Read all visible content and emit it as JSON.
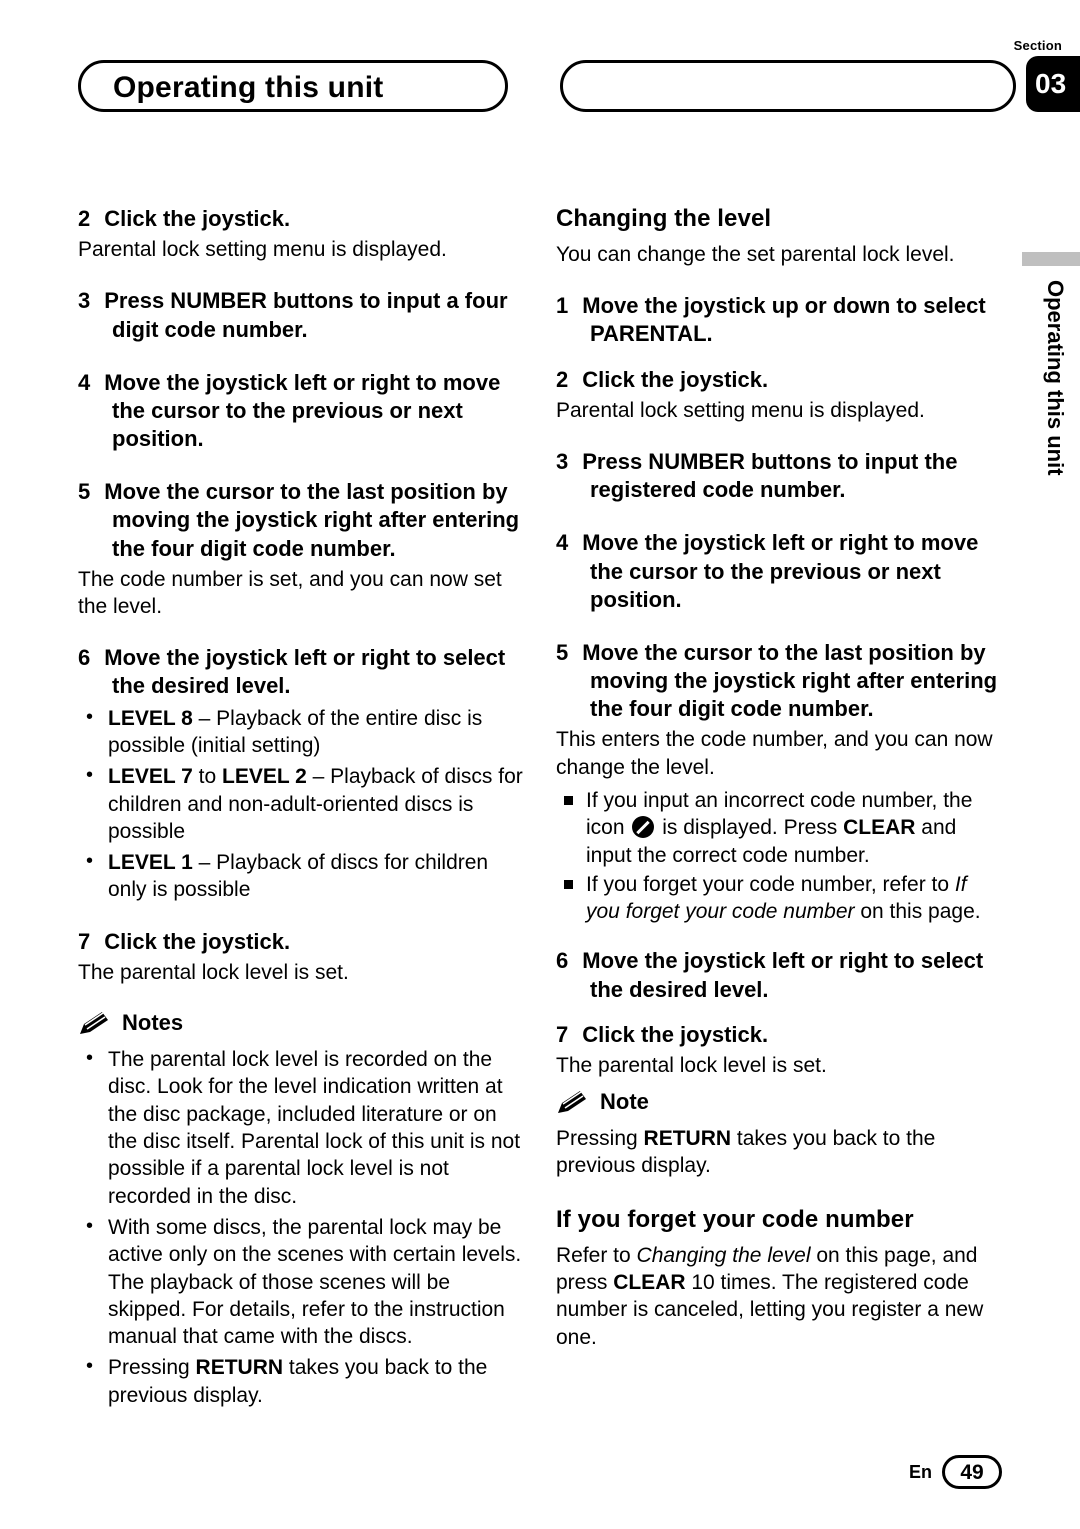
{
  "header": {
    "title": "Operating this unit",
    "section_label": "Section",
    "section_number": "03"
  },
  "side_tab": {
    "text": "Operating this unit"
  },
  "left_column": {
    "step2": {
      "num": "2",
      "text": "Click the joystick."
    },
    "step2_body": "Parental lock setting menu is displayed.",
    "step3": {
      "num": "3",
      "text": "Press NUMBER buttons to input a four digit code number."
    },
    "step4": {
      "num": "4",
      "text": "Move the joystick left or right to move the cursor to the previous or next position."
    },
    "step5": {
      "num": "5",
      "text": "Move the cursor to the last position by moving the joystick right after entering the four digit code number."
    },
    "step5_body": "The code number is set, and you can now set the level.",
    "step6": {
      "num": "6",
      "text": "Move the joystick left or right to select the desired level."
    },
    "levels": [
      {
        "bold": "LEVEL 8",
        "rest": " – Playback of the entire disc is possible (initial setting)"
      },
      {
        "bold": "LEVEL 7",
        "mid": " to ",
        "bold2": "LEVEL 2",
        "rest": " – Playback of discs for children and non-adult-oriented discs is possible"
      },
      {
        "bold": "LEVEL 1",
        "rest": " – Playback of discs for children only is possible"
      }
    ],
    "step7": {
      "num": "7",
      "text": "Click the joystick."
    },
    "step7_body": "The parental lock level is set.",
    "notes_label": "Notes",
    "notes": [
      "The parental lock level is recorded on the disc. Look for the level indication written at the disc package, included literature or on the disc itself. Parental lock of this unit is not possible if a parental lock level is not recorded in the disc.",
      "With some discs, the parental lock may be active only on the scenes with certain levels. The playback of those scenes will be skipped. For details, refer to the instruction manual that came with the discs.",
      "Pressing RETURN takes you back to the previous display."
    ],
    "note3_pre": "Pressing ",
    "note3_bold": "RETURN",
    "note3_post": " takes you back to the previous display."
  },
  "right_column": {
    "heading1": "Changing the level",
    "intro": "You can change the set parental lock level.",
    "step1": {
      "num": "1",
      "text": "Move the joystick up or down to select PARENTAL."
    },
    "step2": {
      "num": "2",
      "text": "Click the joystick."
    },
    "step2_body": "Parental lock setting menu is displayed.",
    "step3": {
      "num": "3",
      "text": "Press NUMBER buttons to input the registered code number."
    },
    "step4": {
      "num": "4",
      "text": "Move the joystick left or right to move the cursor to the previous or next position."
    },
    "step5": {
      "num": "5",
      "text": "Move the cursor to the last position by moving the joystick right after entering the four digit code number."
    },
    "step5_body": "This enters the code number, and you can now change the level.",
    "sq1_pre": "If you input an incorrect code number, the icon ",
    "sq1_mid": " is displayed. Press ",
    "sq1_bold": "CLEAR",
    "sq1_post": " and input the correct code number.",
    "sq2_pre": "If you forget your code number, refer to ",
    "sq2_italic": "If you forget your code number",
    "sq2_post": " on this page.",
    "step6": {
      "num": "6",
      "text": "Move the joystick left or right to select the desired level."
    },
    "step7": {
      "num": "7",
      "text": "Click the joystick."
    },
    "step7_body": "The parental lock level is set.",
    "note_label": "Note",
    "note_pre": "Pressing ",
    "note_bold": "RETURN",
    "note_post": " takes you back to the previous display.",
    "heading2": "If you forget your code number",
    "forget_pre": "Refer to ",
    "forget_italic": "Changing the level",
    "forget_mid": " on this page, and press ",
    "forget_bold": "CLEAR",
    "forget_post": " 10 times. The registered code number is canceled, letting you register a new one."
  },
  "footer": {
    "lang": "En",
    "page": "49"
  }
}
